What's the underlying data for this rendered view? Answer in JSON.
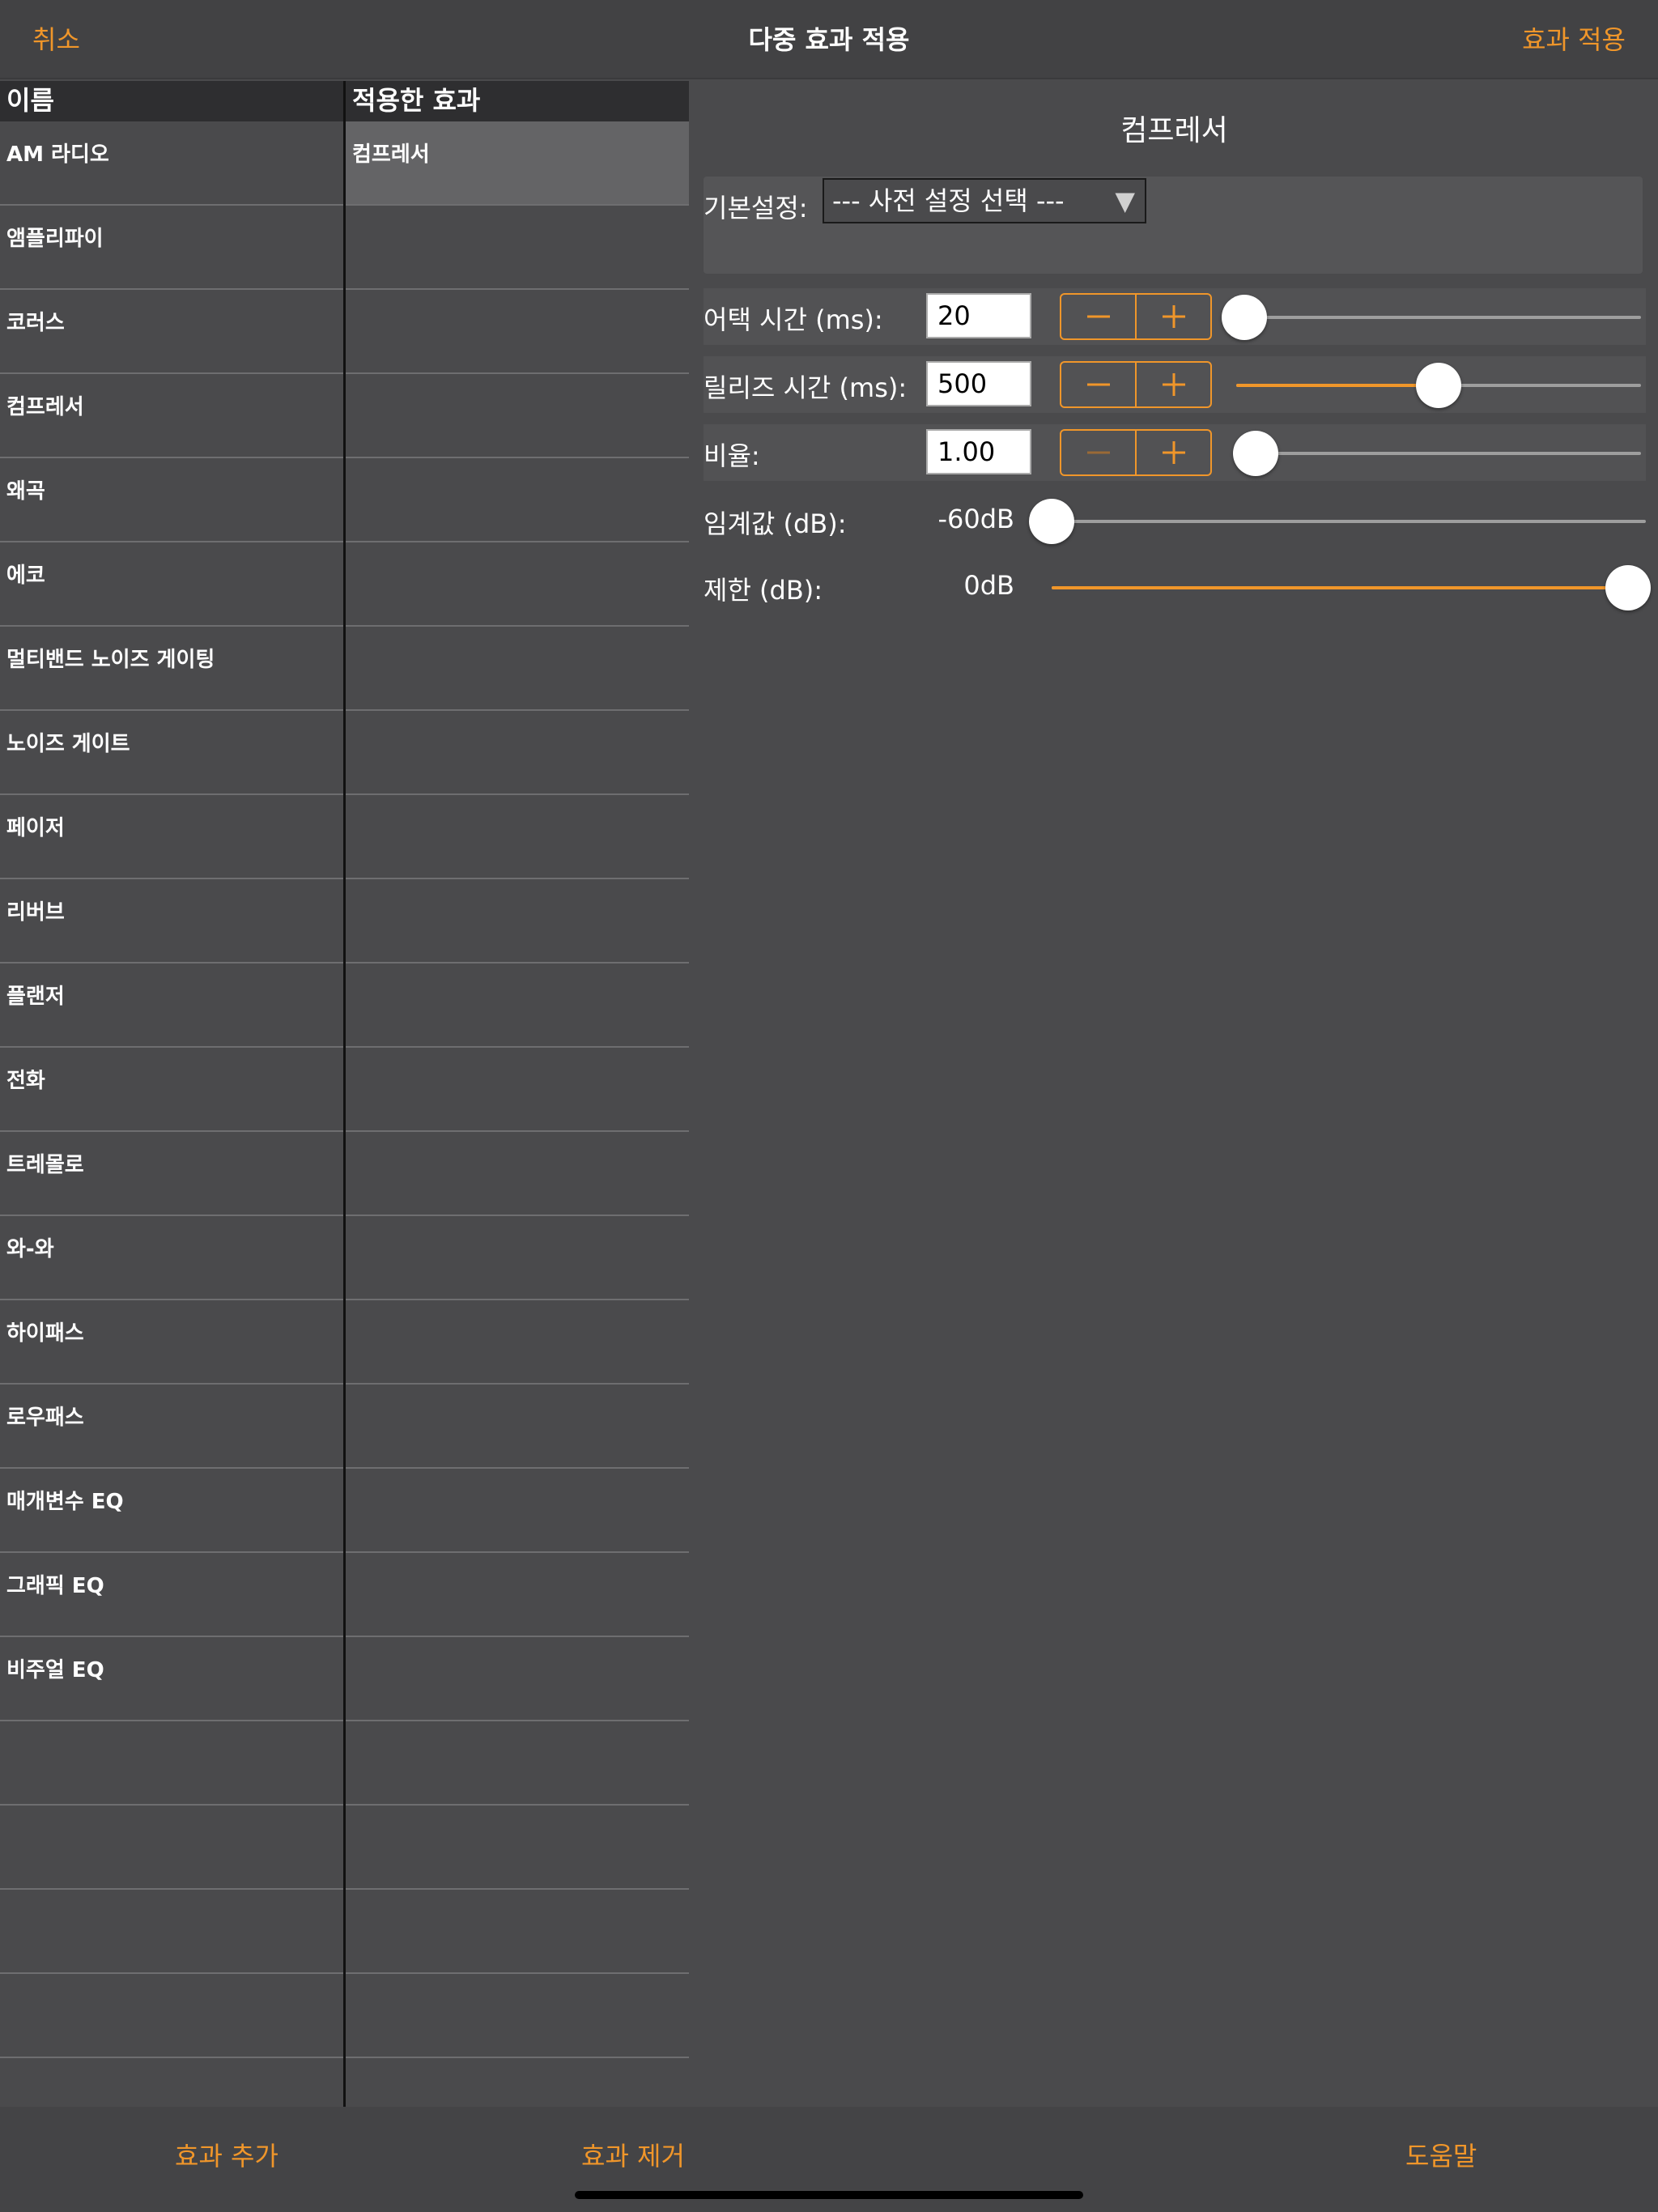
{
  "nav": {
    "cancel_label": "취소",
    "title": "다중 효과 적용",
    "apply_label": "효과 적용"
  },
  "effects_list": {
    "header": "이름",
    "items": [
      "AM 라디오",
      "앰플리파이",
      "코러스",
      "컴프레서",
      "왜곡",
      "에코",
      "멀티밴드 노이즈 게이팅",
      "노이즈 게이트",
      "페이저",
      "리버브",
      "플랜저",
      "전화",
      "트레몰로",
      "와-와",
      "하이패스",
      "로우패스",
      "매개변수 EQ",
      "그래픽 EQ",
      "비주얼 EQ"
    ]
  },
  "applied_list": {
    "header": "적용한 효과",
    "items": [
      "컴프레서"
    ]
  },
  "settings": {
    "title": "컴프레서",
    "preset_label": "기본설정:",
    "preset_value": "--- 사전 설정 선택 ---",
    "params": {
      "attack": {
        "label": "어택 시간 (ms):",
        "value": "20",
        "level": 0.02
      },
      "release": {
        "label": "릴리즈 시간 (ms):",
        "value": "500",
        "level": 0.5
      },
      "ratio": {
        "label": "비율:",
        "value": "1.00",
        "level": 0.0
      },
      "threshold": {
        "label": "임계값 (dB):",
        "value": "-60dB",
        "level": 0.0
      },
      "limit": {
        "label": "제한 (dB):",
        "value": "0dB",
        "level": 1.0
      }
    }
  },
  "bottom_bar": {
    "add_label": "효과 추가",
    "remove_label": "효과 제거",
    "help_label": "도움말"
  },
  "colors": {
    "accent": "#f0962a",
    "background": "#4a4a4c"
  }
}
